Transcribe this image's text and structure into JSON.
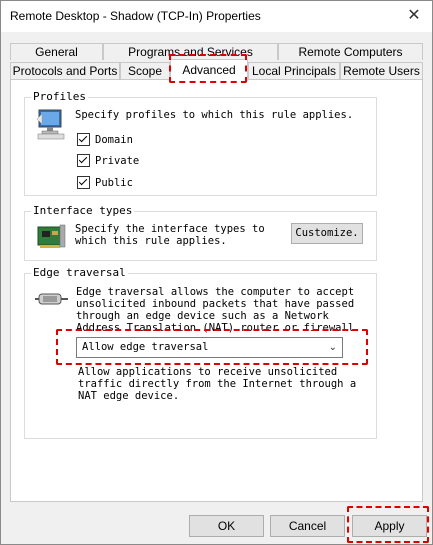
{
  "window": {
    "title": "Remote Desktop - Shadow (TCP-In) Properties",
    "close_glyph": "✕"
  },
  "tabs_row1": [
    "General",
    "Programs and Services",
    "Remote Computers"
  ],
  "tabs_row2": [
    "Protocols and Ports",
    "Scope",
    "Advanced",
    "Local Principals",
    "Remote Users"
  ],
  "profiles": {
    "legend": "Profiles",
    "desc": "Specify profiles to which this rule applies.",
    "items": [
      {
        "label": "Domain",
        "checked": true
      },
      {
        "label": "Private",
        "checked": true
      },
      {
        "label": "Public",
        "checked": true
      }
    ],
    "icon": "computer-profile-icon"
  },
  "interface_types": {
    "legend": "Interface types",
    "desc_line1": "Specify the interface types to",
    "desc_line2": "which this rule applies.",
    "button": "Customize.",
    "icon": "network-card-icon"
  },
  "edge_traversal": {
    "legend": "Edge traversal",
    "desc_lines": [
      "Edge traversal allows the computer to accept",
      "unsolicited inbound packets that have passed",
      "through an edge device such as a Network",
      "Address Translation (NAT) router or firewall."
    ],
    "selected": "Allow edge traversal",
    "help_lines": [
      "Allow applications to receive unsolicited",
      "traffic directly from the Internet through a",
      "NAT edge device."
    ],
    "icon": "cable-connector-icon"
  },
  "buttons": {
    "ok": "OK",
    "cancel": "Cancel",
    "apply": "Apply"
  },
  "colors": {
    "highlight": "#e00000"
  }
}
